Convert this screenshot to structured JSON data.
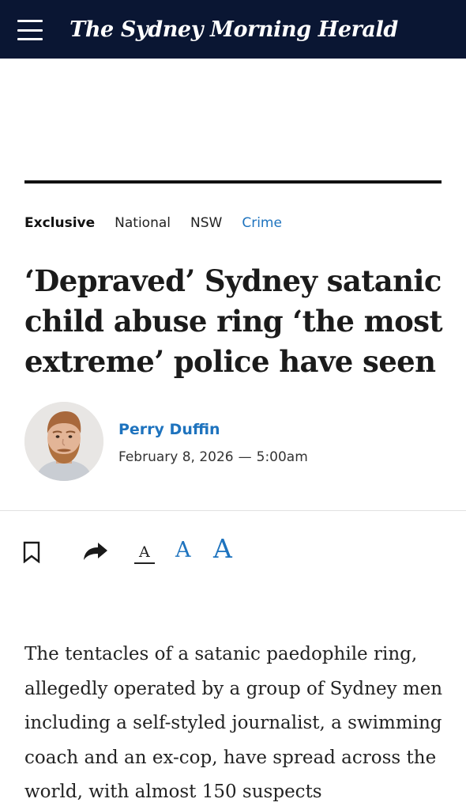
{
  "header": {
    "masthead": "The Sydney Morning Herald",
    "menu_icon": "hamburger-menu-icon",
    "background": "#0a1633"
  },
  "tags": {
    "exclusive": "Exclusive",
    "national": "National",
    "nsw": "NSW",
    "crime": "Crime"
  },
  "article": {
    "headline": "‘Depraved’ Sydney satanic child abuse ring ‘the most extreme’ police have seen",
    "author": "Perry Duffin",
    "date": "February 8, 2026",
    "date_separator": "—",
    "time": "5:00am",
    "body": "The tentacles of a satanic paedophile ring, allegedly operated by a group of Sydney men including a self-styled journalist, a swimming coach and an ex-cop, have spread across the world, with almost 150 suspects"
  },
  "toolbar": {
    "bookmark_icon": "bookmark-icon",
    "share_icon": "share-arrow-icon",
    "font_small": "A",
    "font_medium": "A",
    "font_large": "A"
  },
  "colors": {
    "link": "#1e73be",
    "text": "#1b1b1b"
  }
}
